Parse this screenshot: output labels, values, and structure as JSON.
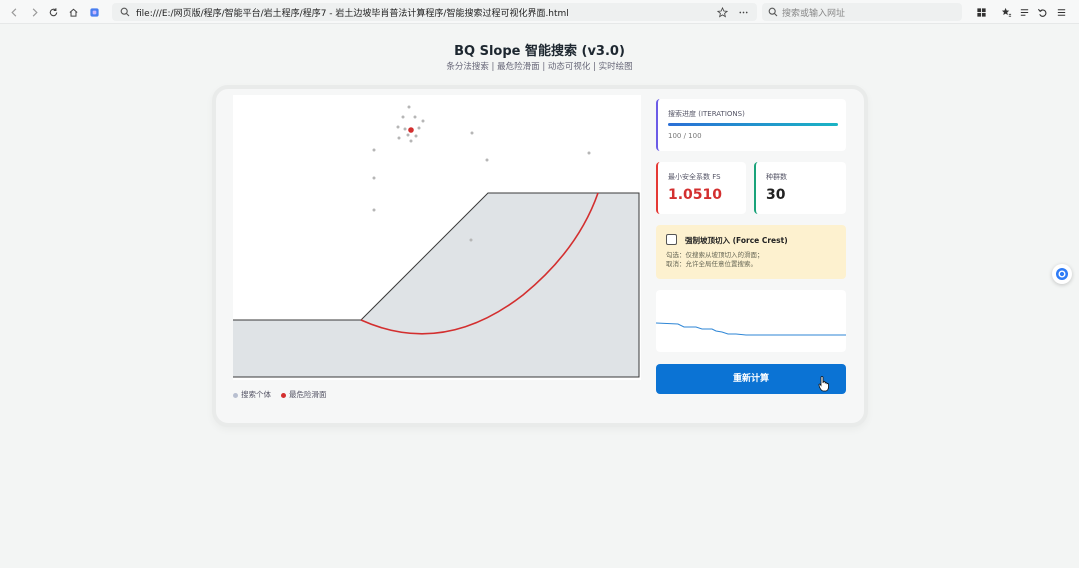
{
  "browser": {
    "url": "file:///E:/网页版/程序/智能平台/岩土程序/程序7 - 岩土边坡毕肖普法计算程序/智能搜索过程可视化界面.html",
    "search_placeholder": "搜索或输入网址"
  },
  "header": {
    "title": "BQ Slope 智能搜索 (v3.0)",
    "subtitle": "条分法搜索 | 最危险滑面 | 动态可视化 | 实时绘图"
  },
  "legend": {
    "population_label": "搜索个体",
    "critical_label": "最危险滑面",
    "population_color": "#b8bfd0",
    "critical_color": "#d32f2f"
  },
  "progress": {
    "label": "搜索进度 (ITERATIONS)",
    "count_text": "100 / 100",
    "fraction": 1.0
  },
  "stats": {
    "fs_label": "最小安全系数 FS",
    "fs_value": "1.0510",
    "population_label": "种群数",
    "population_value": "30"
  },
  "force_crest": {
    "title": "强制坡顶切入 (Force Crest)",
    "desc_line1": "勾选：仅搜索从坡顶切入的滑面；",
    "desc_line2": "取消：允许全局任意位置搜索。",
    "checked": false
  },
  "actions": {
    "recalculate_label": "重新计算"
  },
  "colors": {
    "accent": "#0b73d4",
    "critical": "#d32f2f",
    "population": "#1aa37a",
    "progress": "#6c5ce7",
    "warning_bg": "#fdf1cf"
  }
}
